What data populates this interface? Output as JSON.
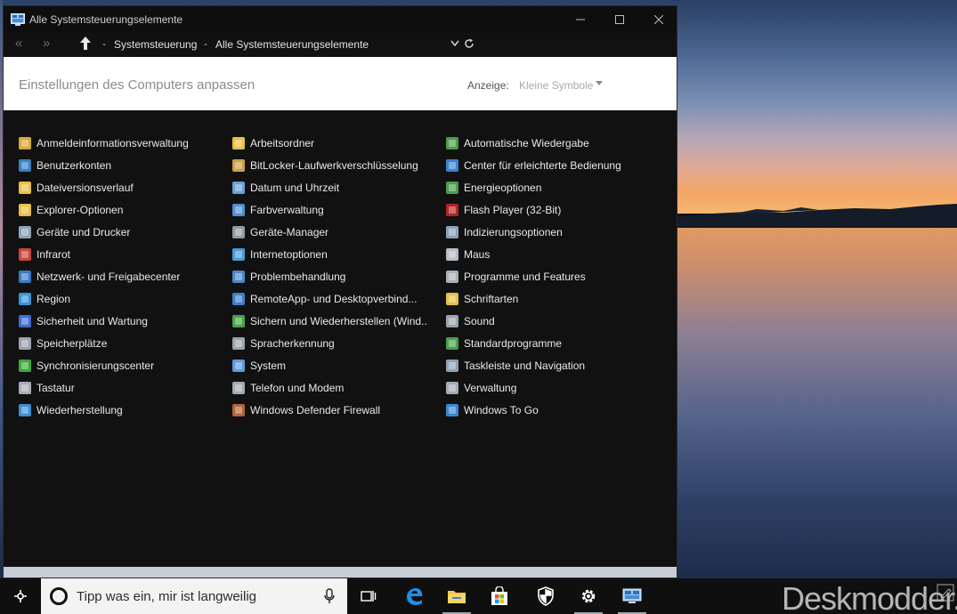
{
  "window": {
    "title": "Alle Systemsteuerungselemente",
    "breadcrumb": [
      "Systemsteuerung",
      "Alle Systemsteuerungselemente"
    ],
    "breadcrumb_sep": "-"
  },
  "header": {
    "heading": "Einstellungen des Computers anpassen",
    "view_label": "Anzeige:",
    "view_value": "Kleine Symbole"
  },
  "columns": [
    {
      "items": [
        {
          "label": "Anmeldeinformationsverwaltung",
          "icon": "credential-vault-icon",
          "color": "#d9a93a"
        },
        {
          "label": "Benutzerkonten",
          "icon": "user-accounts-icon",
          "color": "#3b7fc4"
        },
        {
          "label": "Dateiversionsverlauf",
          "icon": "file-history-icon",
          "color": "#e8c048"
        },
        {
          "label": "Explorer-Optionen",
          "icon": "folder-options-icon",
          "color": "#e8c048"
        },
        {
          "label": "Geräte und Drucker",
          "icon": "devices-printers-icon",
          "color": "#8fa2b5"
        },
        {
          "label": "Infrarot",
          "icon": "infrared-icon",
          "color": "#c9463d"
        },
        {
          "label": "Netzwerk- und Freigabecenter",
          "icon": "network-center-icon",
          "color": "#3d78c5"
        },
        {
          "label": "Region",
          "icon": "region-globe-icon",
          "color": "#3a93d6"
        },
        {
          "label": "Sicherheit und Wartung",
          "icon": "security-flag-icon",
          "color": "#3d6ccf"
        },
        {
          "label": "Speicherplätze",
          "icon": "storage-spaces-icon",
          "color": "#9aa3ad"
        },
        {
          "label": "Synchronisierungscenter",
          "icon": "sync-center-icon",
          "color": "#3fa83c"
        },
        {
          "label": "Tastatur",
          "icon": "keyboard-icon",
          "color": "#a8adb3"
        },
        {
          "label": "Wiederherstellung",
          "icon": "recovery-icon",
          "color": "#3a8fd0"
        }
      ]
    },
    {
      "items": [
        {
          "label": "Arbeitsordner",
          "icon": "work-folders-icon",
          "color": "#e8c048"
        },
        {
          "label": "BitLocker-Laufwerkverschlüsselung",
          "icon": "bitlocker-icon",
          "color": "#c9a04a"
        },
        {
          "label": "Datum und Uhrzeit",
          "icon": "date-time-icon",
          "color": "#6a9fd6"
        },
        {
          "label": "Farbverwaltung",
          "icon": "color-management-icon",
          "color": "#4f8fd0"
        },
        {
          "label": "Geräte-Manager",
          "icon": "device-manager-icon",
          "color": "#8f9aa6"
        },
        {
          "label": "Internetoptionen",
          "icon": "internet-options-icon",
          "color": "#4a9ad8"
        },
        {
          "label": "Problembehandlung",
          "icon": "troubleshooting-icon",
          "color": "#4f86c8"
        },
        {
          "label": "RemoteApp- und Desktopverbind...",
          "icon": "remoteapp-icon",
          "color": "#3f7ec8"
        },
        {
          "label": "Sichern und Wiederherstellen (Wind...",
          "icon": "backup-restore-icon",
          "color": "#4aa24a"
        },
        {
          "label": "Spracherkennung",
          "icon": "speech-recognition-icon",
          "color": "#9aa3ad"
        },
        {
          "label": "System",
          "icon": "system-icon",
          "color": "#5d9bd8"
        },
        {
          "label": "Telefon und Modem",
          "icon": "phone-modem-icon",
          "color": "#a3aab2"
        },
        {
          "label": "Windows Defender Firewall",
          "icon": "firewall-icon",
          "color": "#b0643a"
        }
      ]
    },
    {
      "items": [
        {
          "label": "Automatische Wiedergabe",
          "icon": "autoplay-icon",
          "color": "#4e9a4b"
        },
        {
          "label": "Center für erleichterte Bedienung",
          "icon": "ease-of-access-icon",
          "color": "#3b83cf"
        },
        {
          "label": "Energieoptionen",
          "icon": "power-options-icon",
          "color": "#4b9c4b"
        },
        {
          "label": "Flash Player (32-Bit)",
          "icon": "flash-player-icon",
          "color": "#b3232a"
        },
        {
          "label": "Indizierungsoptionen",
          "icon": "indexing-options-icon",
          "color": "#8ea1b4"
        },
        {
          "label": "Maus",
          "icon": "mouse-icon",
          "color": "#b6bcc3"
        },
        {
          "label": "Programme und Features",
          "icon": "programs-features-icon",
          "color": "#a9afb6"
        },
        {
          "label": "Schriftarten",
          "icon": "fonts-icon",
          "color": "#e2c04a"
        },
        {
          "label": "Sound",
          "icon": "sound-icon",
          "color": "#9aa3ad"
        },
        {
          "label": "Standardprogramme",
          "icon": "default-programs-icon",
          "color": "#46a04a"
        },
        {
          "label": "Taskleiste und Navigation",
          "icon": "taskbar-navigation-icon",
          "color": "#8fa1b3"
        },
        {
          "label": "Verwaltung",
          "icon": "administrative-tools-icon",
          "color": "#a3aab2"
        },
        {
          "label": "Windows To Go",
          "icon": "windows-to-go-icon",
          "color": "#3a87d3"
        }
      ]
    }
  ],
  "taskbar": {
    "search_placeholder": "Tipp was ein, mir ist langweilig",
    "apps": [
      "task-view-icon",
      "edge-icon",
      "file-explorer-icon",
      "store-icon",
      "defender-shield-icon",
      "settings-gear-icon",
      "control-panel-icon"
    ]
  },
  "watermark": "Deskmodder.de"
}
